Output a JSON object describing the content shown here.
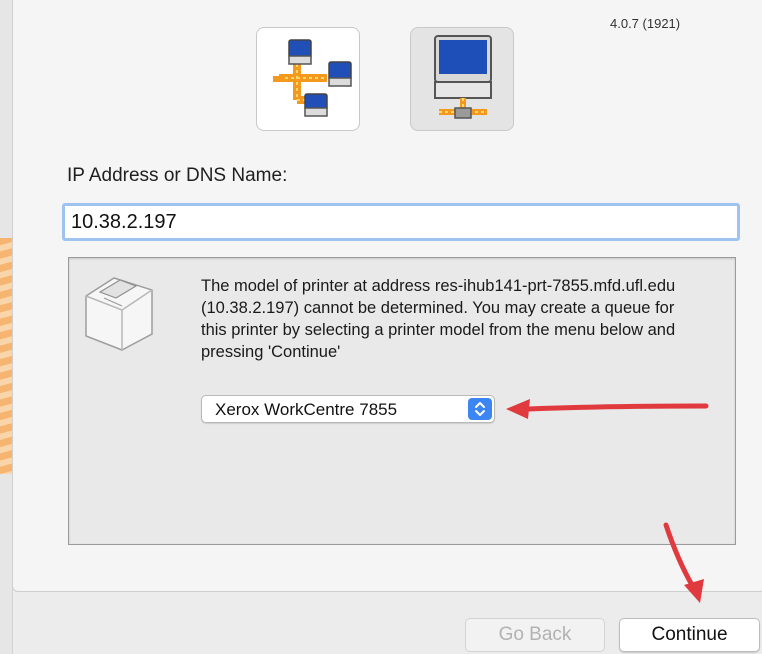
{
  "version": "4.0.7 (1921)",
  "toolbar": {
    "network_icon": "network-printers-icon",
    "ip_icon": "ip-printer-icon"
  },
  "ip_section": {
    "label": "IP Address or DNS Name:",
    "value": "10.38.2.197"
  },
  "info": {
    "icon": "printer-icon",
    "message": "The model of printer at address res-ihub141-prt-7855.mfd.ufl.edu (10.38.2.197) cannot be determined. You may create a queue for this printer by selecting a printer model from the menu below and pressing 'Continue'",
    "model_selected": "Xerox WorkCentre 7855"
  },
  "buttons": {
    "go_back": "Go Back",
    "continue": "Continue"
  },
  "colors": {
    "accent": "#3b86f2",
    "annotation_arrow": "#e0393e",
    "focus_ring": "#9fc3f0"
  }
}
